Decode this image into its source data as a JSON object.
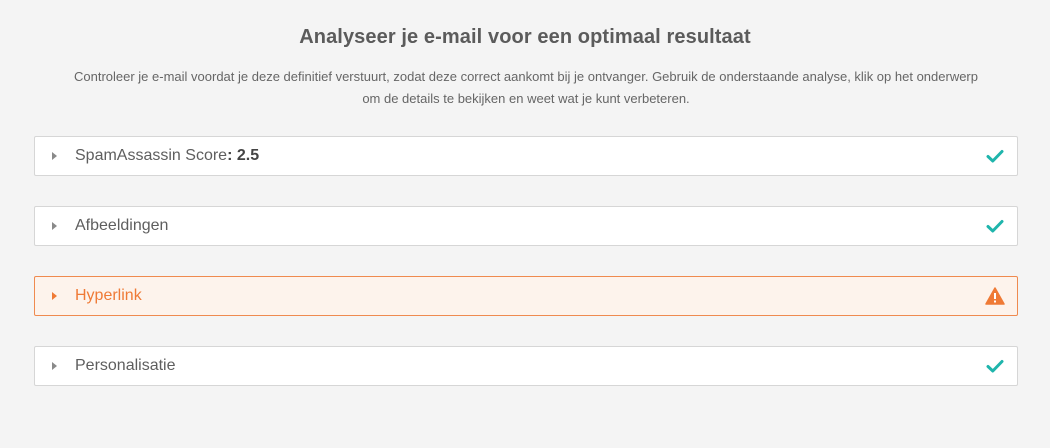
{
  "header": {
    "title": "Analyseer je e-mail voor een optimaal resultaat",
    "intro_line1": "Controleer je e-mail voordat je deze definitief verstuurt, zodat deze correct aankomt bij je ontvanger. Gebruik de onderstaande analyse, klik op het onderwerp",
    "intro_line2": "om de details te bekijken en weet wat je kunt verbeteren."
  },
  "checks": [
    {
      "label": "SpamAssassin Score",
      "separator": ":",
      "value": "2.5",
      "status": "ok",
      "status_icon": "check-icon"
    },
    {
      "label": "Afbeeldingen",
      "status": "ok",
      "status_icon": "check-icon"
    },
    {
      "label": "Hyperlink",
      "status": "warning",
      "status_icon": "warning-icon"
    },
    {
      "label": "Personalisatie",
      "status": "ok",
      "status_icon": "check-icon"
    }
  ],
  "colors": {
    "ok": "#1fb5ac",
    "warning": "#ef7a36",
    "background": "#f4f4f4"
  }
}
